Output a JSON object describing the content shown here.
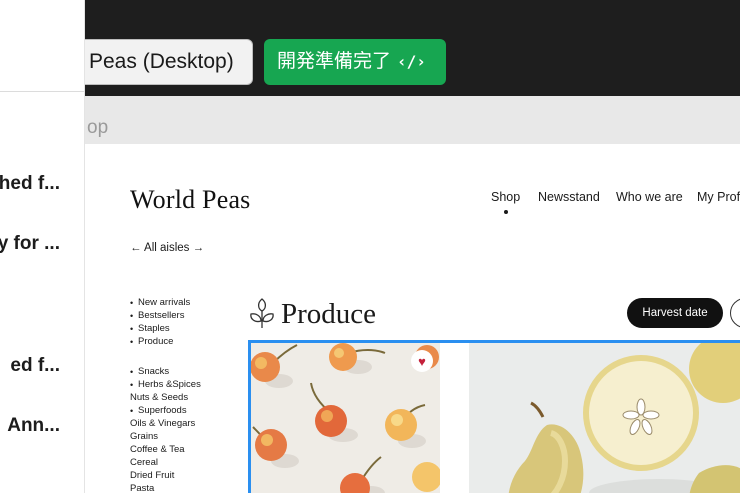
{
  "left_panel": {
    "items": [
      "hed f...",
      "y for ...",
      "ed f...",
      "Ann..."
    ]
  },
  "header": {
    "file_tab_label": "Peas (Desktop)",
    "status_badge_label": "開発準備完了",
    "status_icon_text": "‹/›"
  },
  "frame": {
    "label": "op"
  },
  "site": {
    "brand": "World Peas",
    "nav": [
      "Shop",
      "Newsstand",
      "Who we are",
      "My Profi"
    ],
    "aisles_label": "← All aisles →",
    "categories_group1": [
      "New arrivals",
      "Bestsellers",
      "Staples",
      "Produce"
    ],
    "categories_group2": [
      {
        "label": "Snacks",
        "bullet": true
      },
      {
        "label": "Herbs &Spices",
        "bullet": true
      },
      {
        "label": "Nuts & Seeds",
        "bullet": false
      },
      {
        "label": "Superfoods",
        "bullet": true
      },
      {
        "label": "Oils & Vinegars",
        "bullet": false
      },
      {
        "label": "Grains",
        "bullet": false
      },
      {
        "label": "Coffee & Tea",
        "bullet": false
      },
      {
        "label": "Cereal",
        "bullet": false
      },
      {
        "label": "Dried Fruit",
        "bullet": false
      },
      {
        "label": "Pasta",
        "bullet": false
      }
    ],
    "section_title": "Produce",
    "sort_button_label": "Harvest date",
    "favorite_icon": "♥"
  },
  "colors": {
    "top_bar": "#1e1e1e",
    "status_green": "#17a651",
    "selection_blue": "#2a8ff0",
    "favorite_red": "#c4203a"
  }
}
